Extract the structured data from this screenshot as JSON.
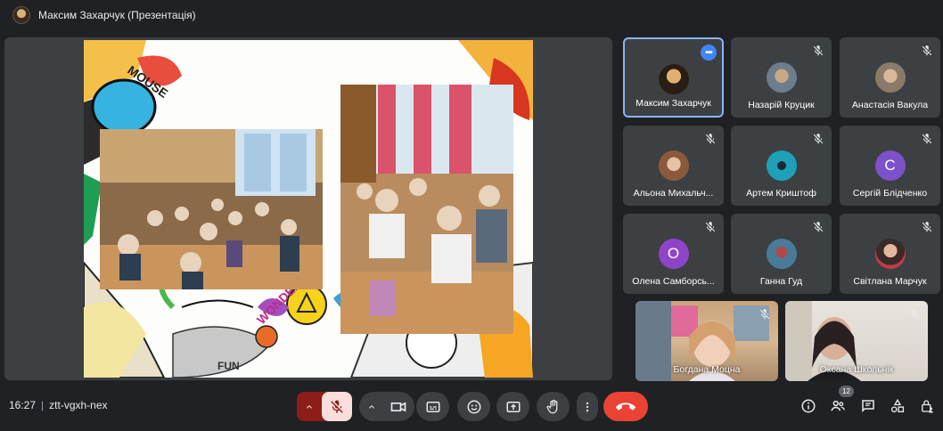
{
  "header": {
    "title": "Максим Захарчук (Презентація)",
    "avatar_icon": "presenter-avatar"
  },
  "slide": {
    "text_mouse": "MOUSE",
    "text_fun": "FUN",
    "text_wonder": "WONDER"
  },
  "participants": [
    {
      "name": "Максим Захарчук",
      "avatar": "photo",
      "muted": false,
      "active": true
    },
    {
      "name": "Назарій Круцик",
      "avatar": "photo",
      "muted": true
    },
    {
      "name": "Анастасія Вакула",
      "avatar": "photo",
      "muted": true
    },
    {
      "name": "Альона Михальч...",
      "avatar": "photo",
      "muted": true
    },
    {
      "name": "Артем Криштоф",
      "avatar": "photo",
      "muted": true
    },
    {
      "name": "Сергій Блідченко",
      "initial": "С",
      "avatar_color": "#7b52c9",
      "muted": true
    },
    {
      "name": "Олена Самборсь...",
      "initial": "О",
      "avatar_color": "#8e44c9",
      "muted": true
    },
    {
      "name": "Ганна Гуд",
      "avatar": "photo",
      "muted": true
    },
    {
      "name": "Світлана Марчук",
      "avatar": "photo",
      "muted": true
    }
  ],
  "video_tiles": [
    {
      "name": "Богдана Моцна",
      "muted": true
    },
    {
      "name": "Оксана Школьнік",
      "muted": true
    }
  ],
  "footer": {
    "time": "16:27",
    "meeting_code": "ztt-vgxh-nex",
    "participants_count": "12"
  },
  "colors": {
    "accent": "#8ab4f8",
    "end_call": "#ea4335",
    "mic_off_bg": "#f9dedc",
    "mic_chevron_bg": "#8c1d18"
  }
}
